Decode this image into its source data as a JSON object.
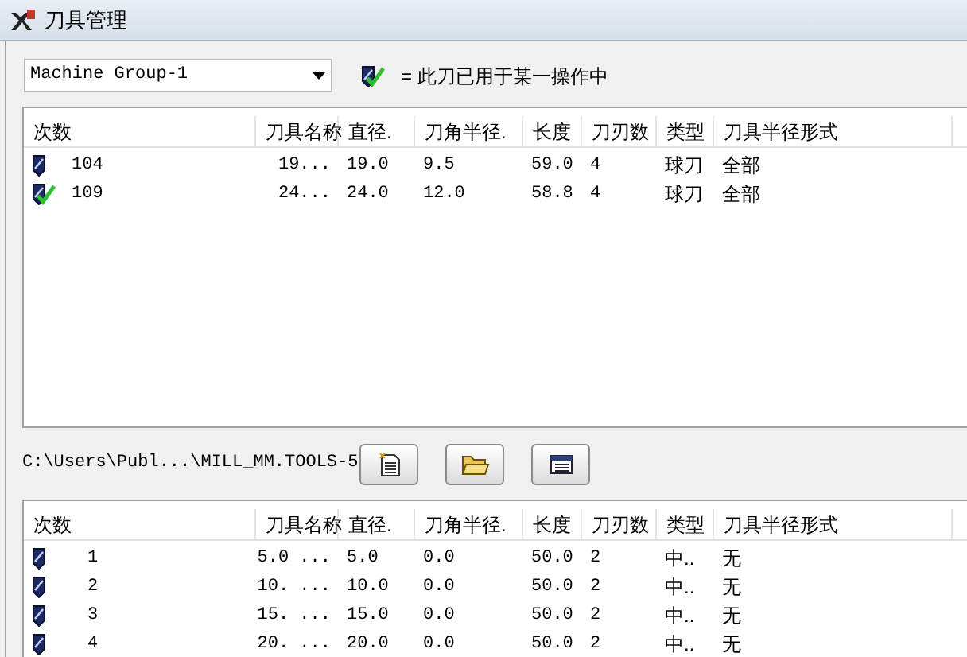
{
  "window": {
    "title": "刀具管理"
  },
  "machine_group": {
    "value": "Machine Group-1"
  },
  "legend": {
    "text": "= 此刀已用于某一操作中"
  },
  "columns": [
    "次数",
    "刀具名称",
    "直径.",
    "刀角半径.",
    "长度",
    "刀刃数",
    "类型",
    "刀具半径形式"
  ],
  "used_tools": [
    {
      "used": false,
      "cells": [
        "104",
        "19...",
        "19.0",
        "9.5",
        "59.0",
        "4",
        "球刀",
        "全部"
      ]
    },
    {
      "used": true,
      "cells": [
        "109",
        "24...",
        "24.0",
        "12.0",
        "58.8",
        "4",
        "球刀",
        "全部"
      ]
    }
  ],
  "library_path": "C:\\Users\\Publ...\\MILL_MM.TOOLS-5",
  "library_columns": [
    "次数",
    "刀具名称",
    "直径.",
    "刀角半径.",
    "长度",
    "刀刃数",
    "类型",
    "刀具半径形式"
  ],
  "library_tools": [
    {
      "used": false,
      "cells": [
        "1",
        "5.0 ...",
        "5.0",
        "0.0",
        "50.0",
        "2",
        "中..",
        "无"
      ]
    },
    {
      "used": false,
      "cells": [
        "2",
        "10. ...",
        "10.0",
        "0.0",
        "50.0",
        "2",
        "中..",
        "无"
      ]
    },
    {
      "used": false,
      "cells": [
        "3",
        "15. ...",
        "15.0",
        "0.0",
        "50.0",
        "2",
        "中..",
        "无"
      ]
    },
    {
      "used": false,
      "cells": [
        "4",
        "20. ...",
        "20.0",
        "0.0",
        "50.0",
        "2",
        "中..",
        "无"
      ]
    }
  ]
}
